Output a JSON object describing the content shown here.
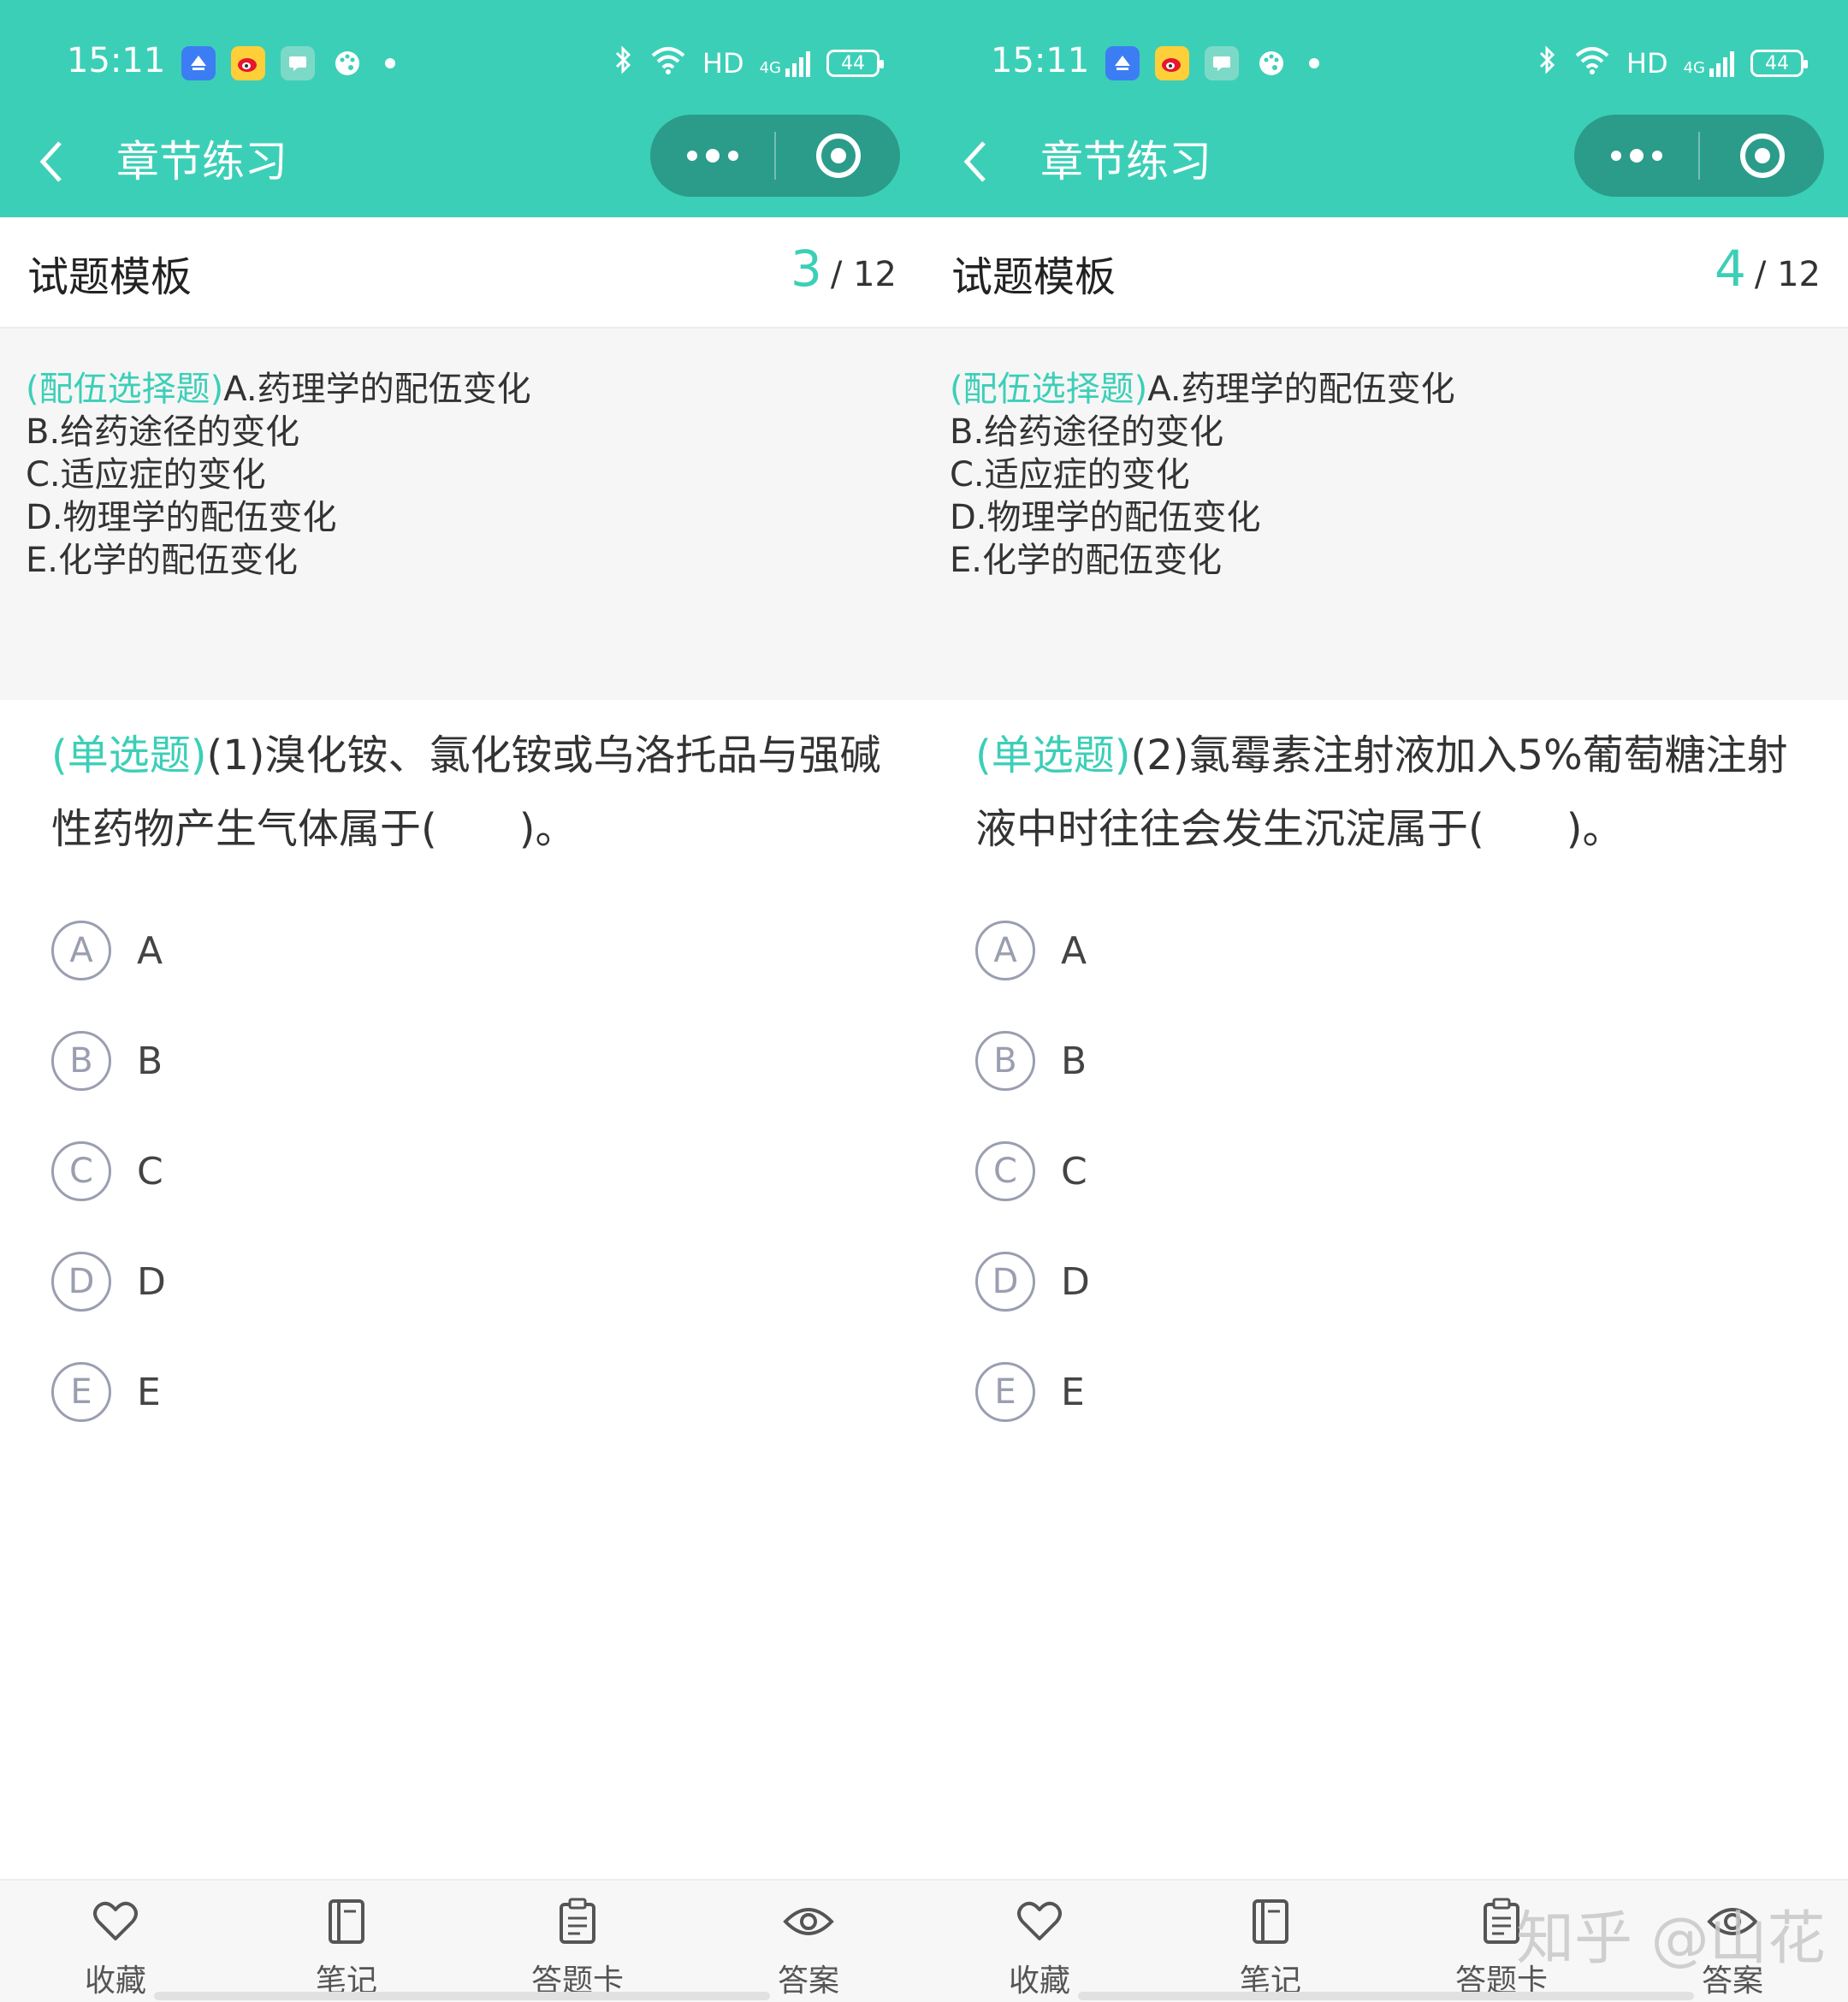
{
  "screens": [
    {
      "status": {
        "time": "15:11",
        "network": "HD",
        "signal": "4G",
        "battery": "44"
      },
      "nav": {
        "title": "章节练习"
      },
      "header": {
        "title": "试题模板",
        "current": "3",
        "total": "/ 12"
      },
      "group": {
        "tag": "(配伍选择题)",
        "lines": [
          "A.药理学的配伍变化",
          "B.给药途径的变化",
          "C.适应症的变化",
          "D.物理学的配伍变化",
          "E.化学的配伍变化"
        ]
      },
      "question": {
        "tag": "(单选题)",
        "text": "(1)溴化铵、氯化铵或乌洛托品与强碱性药物产生气体属于(　　)。"
      },
      "options": [
        {
          "letter": "A",
          "text": "A"
        },
        {
          "letter": "B",
          "text": "B"
        },
        {
          "letter": "C",
          "text": "C"
        },
        {
          "letter": "D",
          "text": "D"
        },
        {
          "letter": "E",
          "text": "E"
        }
      ],
      "tabs": [
        {
          "label": "收藏",
          "icon": "heart-icon"
        },
        {
          "label": "笔记",
          "icon": "notebook-icon"
        },
        {
          "label": "答题卡",
          "icon": "clipboard-icon"
        },
        {
          "label": "答案",
          "icon": "eye-icon"
        }
      ]
    },
    {
      "status": {
        "time": "15:11",
        "network": "HD",
        "signal": "4G",
        "battery": "44"
      },
      "nav": {
        "title": "章节练习"
      },
      "header": {
        "title": "试题模板",
        "current": "4",
        "total": "/ 12"
      },
      "group": {
        "tag": "(配伍选择题)",
        "lines": [
          "A.药理学的配伍变化",
          "B.给药途径的变化",
          "C.适应症的变化",
          "D.物理学的配伍变化",
          "E.化学的配伍变化"
        ]
      },
      "question": {
        "tag": "(单选题)",
        "text": "(2)氯霉素注射液加入5%葡萄糖注射液中时往往会发生沉淀属于(　　)。"
      },
      "options": [
        {
          "letter": "A",
          "text": "A"
        },
        {
          "letter": "B",
          "text": "B"
        },
        {
          "letter": "C",
          "text": "C"
        },
        {
          "letter": "D",
          "text": "D"
        },
        {
          "letter": "E",
          "text": "E"
        }
      ],
      "tabs": [
        {
          "label": "收藏",
          "icon": "heart-icon"
        },
        {
          "label": "笔记",
          "icon": "notebook-icon"
        },
        {
          "label": "答题卡",
          "icon": "clipboard-icon"
        },
        {
          "label": "答案",
          "icon": "eye-icon"
        }
      ]
    }
  ],
  "watermark": "知乎 @山花",
  "colors": {
    "accent": "#3ccfb7",
    "capsule": "#2b9c8a",
    "option_circle": "#9a9eb0"
  }
}
